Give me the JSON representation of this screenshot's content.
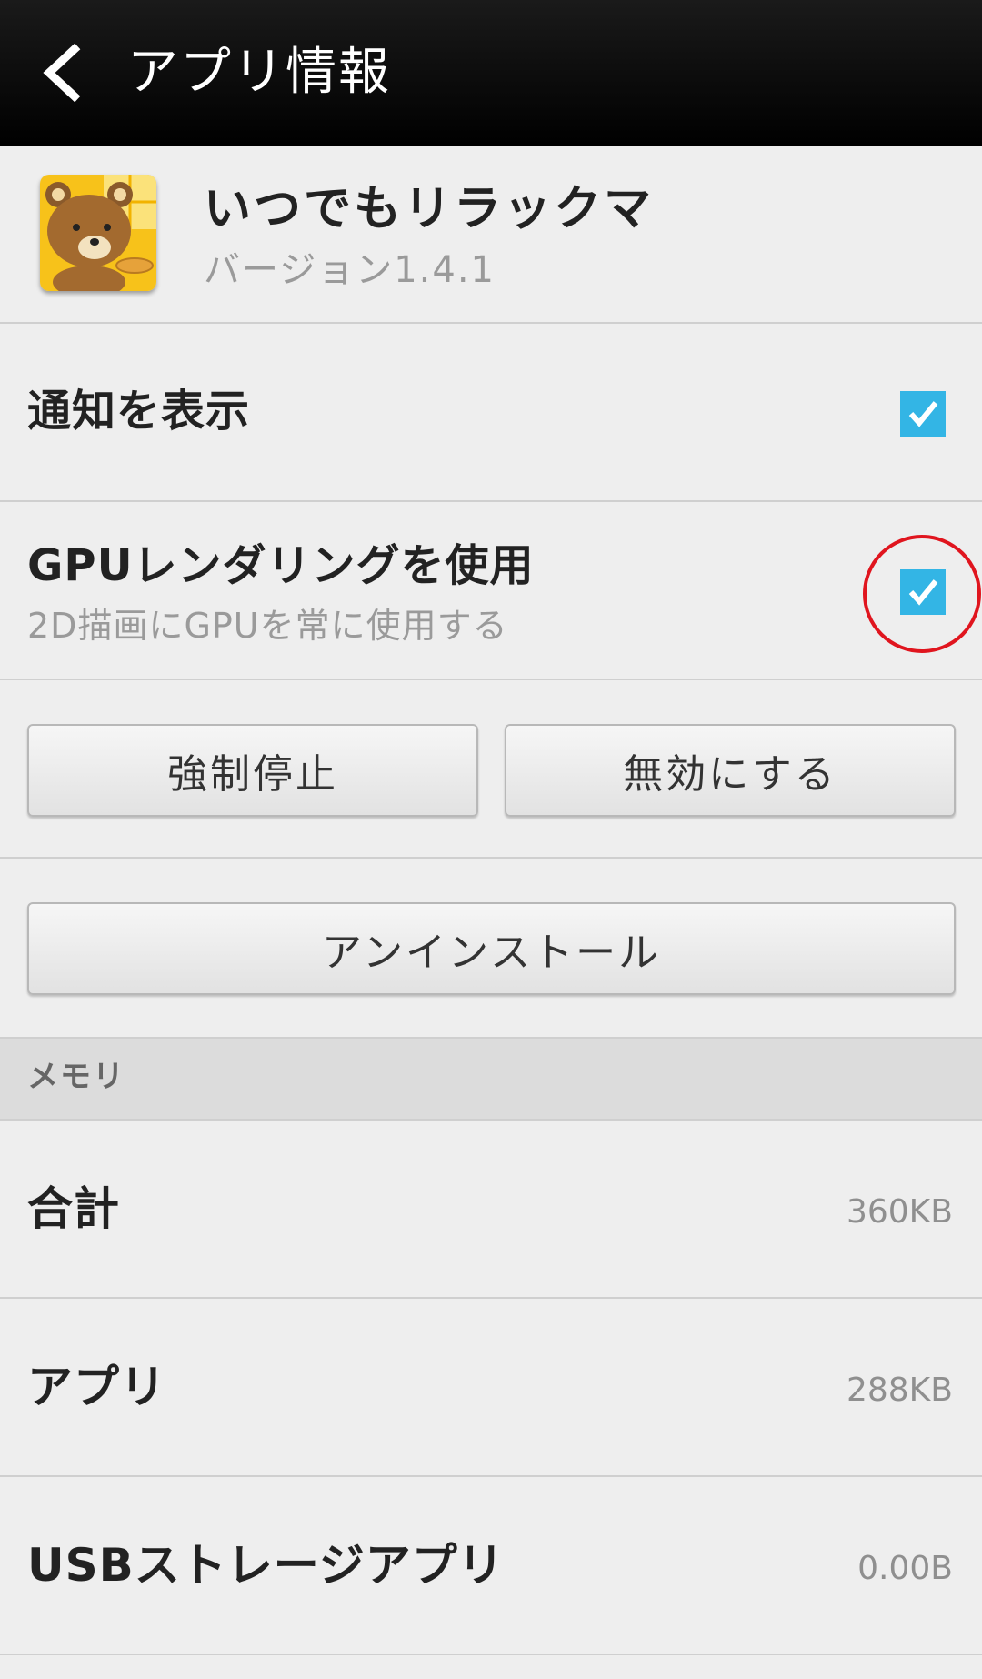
{
  "header": {
    "title": "アプリ情報",
    "back_icon": "chevron-left-icon"
  },
  "app": {
    "name": "いつでもリラックマ",
    "version": "バージョン1.4.1"
  },
  "preferences": [
    {
      "title": "通知を表示",
      "checked": true
    },
    {
      "title": "GPUレンダリングを使用",
      "summary": "2D描画にGPUを常に使用する",
      "checked": true
    }
  ],
  "buttons": {
    "force_stop": "強制停止",
    "disable": "無効にする",
    "uninstall": "アンインストール"
  },
  "memory": {
    "section_title": "メモリ",
    "rows": [
      {
        "label": "合計",
        "value": "360KB"
      },
      {
        "label": "アプリ",
        "value": "288KB"
      },
      {
        "label": "USBストレージアプリ",
        "value": "0.00B"
      }
    ]
  },
  "colors": {
    "accent": "#33b5e5",
    "highlight_circle": "#e0151e",
    "header_bg": "#000000"
  }
}
